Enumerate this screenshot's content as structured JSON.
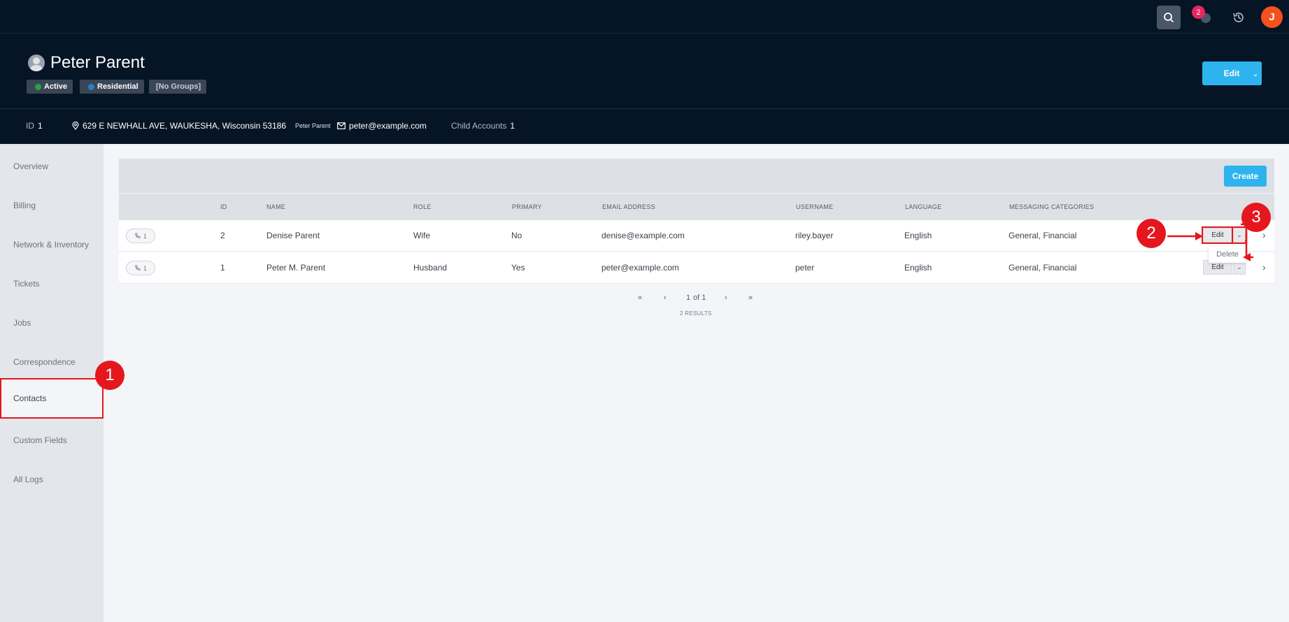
{
  "topbar": {
    "notification_count": "2",
    "avatar_initial": "J",
    "icons": [
      "search-icon",
      "help-icon",
      "history-icon"
    ]
  },
  "header": {
    "title": "Peter Parent",
    "tags": {
      "status": "Active",
      "type": "Residential",
      "groups": "[No Groups]"
    },
    "status_color": "#25a244",
    "type_color": "#2a7fc4",
    "edit_label": "Edit"
  },
  "info": {
    "id_label": "ID",
    "id_value": "1",
    "address": "629 E NEWHALL AVE, WAUKESHA, Wisconsin 53186",
    "address_owner": "Peter Parent",
    "email": "peter@example.com",
    "child_accounts_label": "Child Accounts",
    "child_accounts_value": "1"
  },
  "sidebar": {
    "items": [
      {
        "label": "Overview"
      },
      {
        "label": "Billing"
      },
      {
        "label": "Network & Inventory"
      },
      {
        "label": "Tickets"
      },
      {
        "label": "Jobs"
      },
      {
        "label": "Correspondence"
      },
      {
        "label": "Contacts"
      },
      {
        "label": "Custom Fields"
      },
      {
        "label": "All Logs"
      }
    ],
    "active": "Contacts"
  },
  "contacts": {
    "create_label": "Create",
    "columns": [
      "ID",
      "NAME",
      "ROLE",
      "PRIMARY",
      "EMAIL ADDRESS",
      "USERNAME",
      "LANGUAGE",
      "MESSAGING CATEGORIES"
    ],
    "rows": [
      {
        "phones": "1",
        "id": "2",
        "name": "Denise Parent",
        "role": "Wife",
        "primary": "No",
        "email": "denise@example.com",
        "username": "riley.bayer",
        "language": "English",
        "categories": "General, Financial",
        "edit": "Edit"
      },
      {
        "phones": "1",
        "id": "1",
        "name": "Peter M. Parent",
        "role": "Husband",
        "primary": "Yes",
        "email": "peter@example.com",
        "username": "peter",
        "language": "English",
        "categories": "General, Financial",
        "edit": "Edit"
      }
    ],
    "dropdown_delete": "Delete",
    "pagination": {
      "first": "«",
      "prev": "‹",
      "current": "1",
      "of_total": "of 1",
      "next": "›",
      "last": "»",
      "results": "2 RESULTS"
    }
  },
  "callouts": [
    "1",
    "2",
    "3"
  ],
  "accent_color": "#2db4ee",
  "annotation_color": "#e5161d"
}
